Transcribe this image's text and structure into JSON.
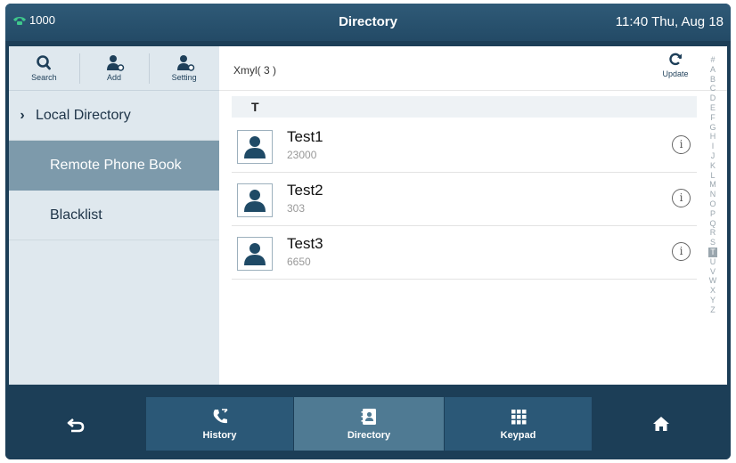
{
  "statusbar": {
    "line": "1000",
    "title": "Directory",
    "datetime": "11:40 Thu, Aug 18",
    "line_icon": "phone-icon"
  },
  "toolbar": {
    "search_label": "Search",
    "add_label": "Add",
    "setting_label": "Setting"
  },
  "sidebar": {
    "items": [
      {
        "label": "Local Directory",
        "chevron": "›"
      },
      {
        "label": "Remote Phone Book"
      },
      {
        "label": "Blacklist"
      }
    ]
  },
  "main": {
    "title": "Xmyl( 3 )",
    "update_label": "Update",
    "section": "T",
    "contacts": [
      {
        "name": "Test1",
        "number": "23000"
      },
      {
        "name": "Test2",
        "number": "303"
      },
      {
        "name": "Test3",
        "number": "6650"
      }
    ],
    "info_glyph": "i",
    "alphabet": [
      "#",
      "A",
      "B",
      "C",
      "D",
      "E",
      "F",
      "G",
      "H",
      "I",
      "J",
      "K",
      "L",
      "M",
      "N",
      "O",
      "P",
      "Q",
      "R",
      "S",
      "T",
      "U",
      "V",
      "W",
      "X",
      "Y",
      "Z"
    ],
    "alphabet_selected": "T"
  },
  "bottombar": {
    "history_label": "History",
    "directory_label": "Directory",
    "keypad_label": "Keypad"
  },
  "colors": {
    "frame": "#1c3e57",
    "sidebar_active": "#7d9aab",
    "tab_selected": "#4f7a93",
    "phone_green": "#3fc88c"
  }
}
